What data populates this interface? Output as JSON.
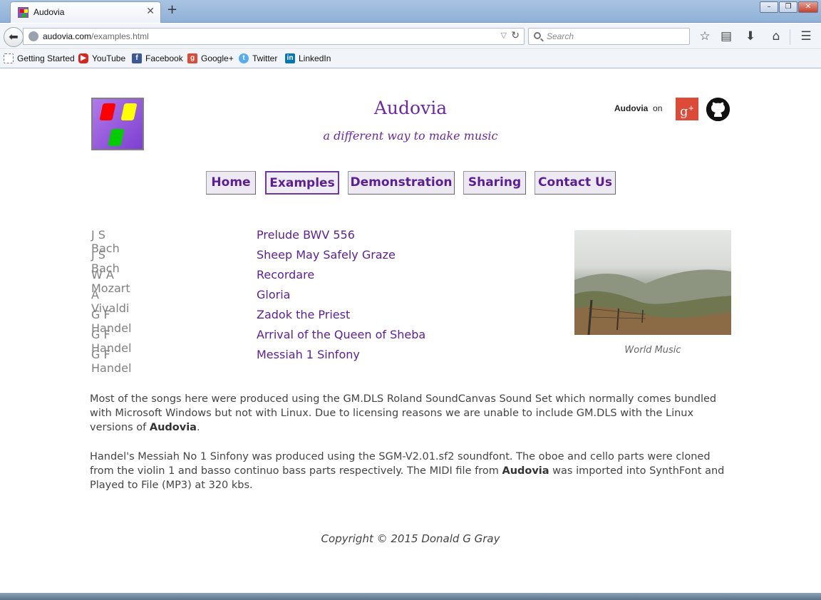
{
  "browser": {
    "tab_title": "Audovia",
    "url_host": "audovia.com",
    "url_path": "/examples.html",
    "search_placeholder": "Search",
    "bookmarks": [
      {
        "label": "Getting Started"
      },
      {
        "label": "YouTube"
      },
      {
        "label": "Facebook"
      },
      {
        "label": "Google+"
      },
      {
        "label": "Twitter"
      },
      {
        "label": "LinkedIn"
      }
    ]
  },
  "header": {
    "title": "Audovia",
    "tagline": "a different way to make music",
    "social_brand": "Audovia",
    "social_suffix": "on"
  },
  "nav": [
    {
      "label": "Home"
    },
    {
      "label": "Examples"
    },
    {
      "label": "Demonstration"
    },
    {
      "label": "Sharing"
    },
    {
      "label": "Contact Us"
    }
  ],
  "examples": [
    {
      "composer": "J S Bach",
      "work": "Prelude BWV 556"
    },
    {
      "composer": "J S Bach",
      "work": "Sheep May Safely Graze"
    },
    {
      "composer": "W A Mozart",
      "work": "Recordare"
    },
    {
      "composer": "A Vivaldi",
      "work": "Gloria"
    },
    {
      "composer": "G F Handel",
      "work": "Zadok the Priest"
    },
    {
      "composer": "G F Handel",
      "work": "Arrival of the Queen of Sheba"
    },
    {
      "composer": "G F Handel",
      "work": "Messiah 1 Sinfony"
    }
  ],
  "photo": {
    "caption": "World Music"
  },
  "paragraphs": {
    "p1_a": "Most of the songs here were produced using the GM.DLS Roland SoundCanvas Sound Set which normally comes bundled with Microsoft Windows but not with Linux.  Due to licensing reasons we are unable to include GM.DLS with the Linux versions of ",
    "p1_b": "Audovia",
    "p1_c": ".",
    "p2_a": "Handel's Messiah No 1 Sinfony was produced using the SGM-V2.01.sf2 soundfont.  The oboe and cello parts were cloned from the violin 1 and basso continuo bass parts respectively.  The MIDI file from ",
    "p2_b": "Audovia",
    "p2_c": " was imported into SynthFont and Played to File (MP3) at 320 kbs."
  },
  "footer": {
    "copyright": "Copyright © 2015  Donald G Gray"
  }
}
